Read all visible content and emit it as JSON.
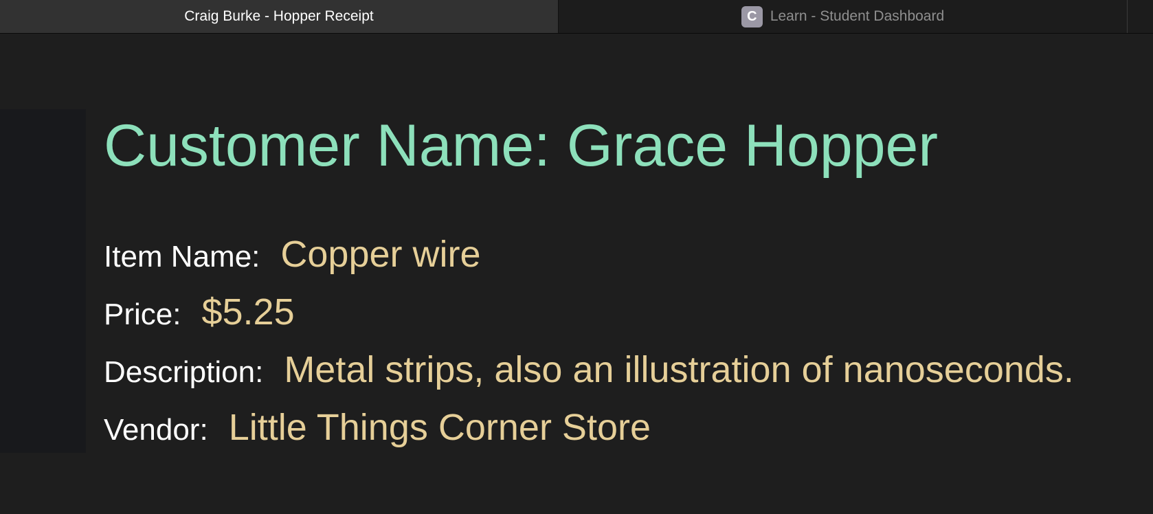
{
  "tabs": [
    {
      "title": "Craig Burke - Hopper Receipt",
      "active": true
    },
    {
      "title": "Learn - Student Dashboard",
      "active": false,
      "favicon_letter": "C"
    }
  ],
  "receipt": {
    "heading": "Customer Name: Grace Hopper",
    "item_label": "Item Name:",
    "item_value": "Copper wire",
    "price_label": "Price:",
    "price_value": "$5.25",
    "description_label": "Description:",
    "description_value": "Metal strips, also an illustration of nanoseconds.",
    "vendor_label": "Vendor:",
    "vendor_value": "Little Things Corner Store"
  },
  "colors": {
    "heading": "#8de0bb",
    "value": "#e6cf98",
    "label": "#ffffff",
    "background": "#1e1e1e"
  }
}
